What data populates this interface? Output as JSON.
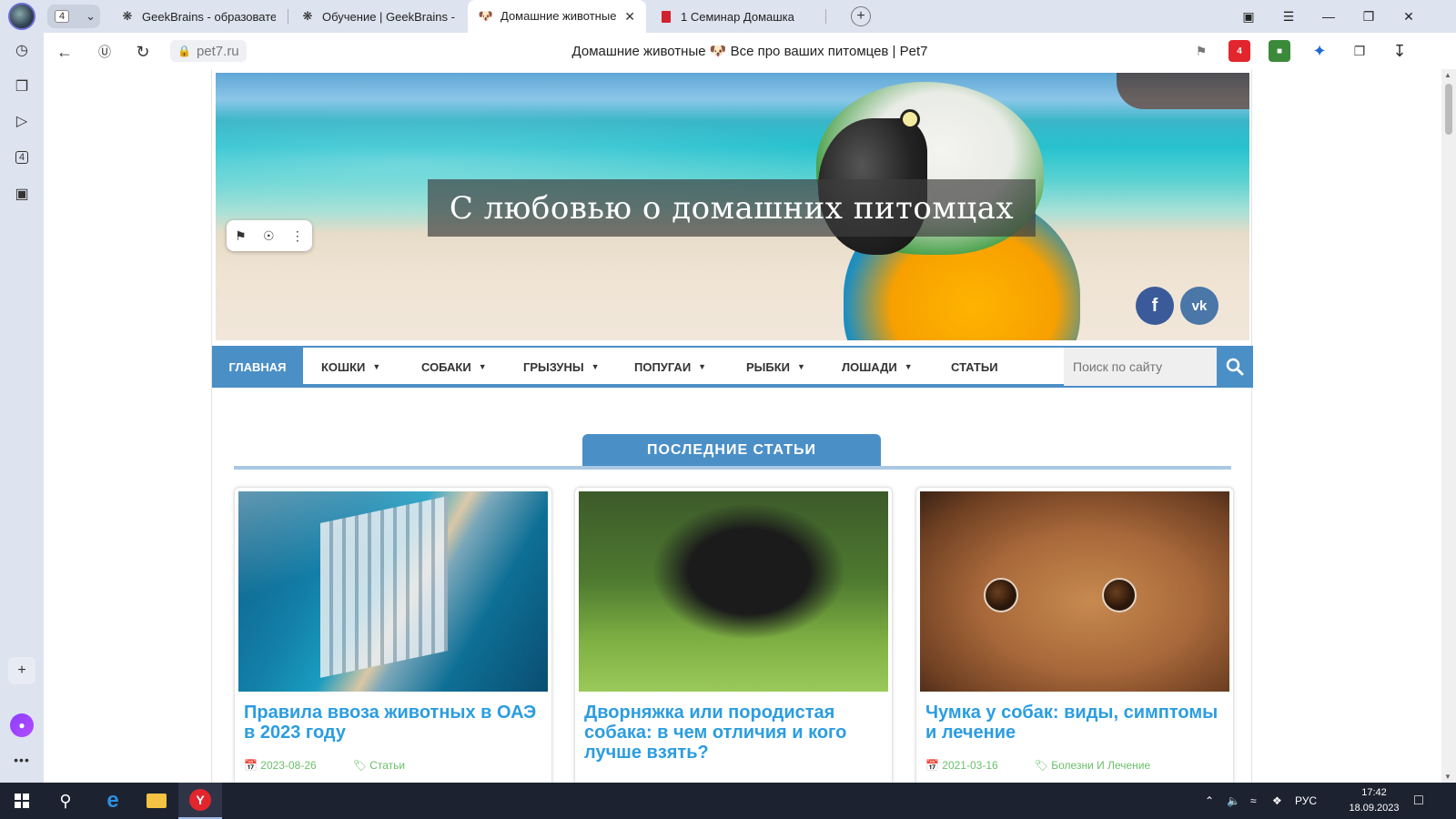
{
  "browser": {
    "tab_group_count": "4",
    "tabs": [
      {
        "title": "GeekBrains - образовател",
        "favicon": "geekbrains-logo"
      },
      {
        "title": "Обучение | GeekBrains - с",
        "favicon": "geekbrains-logo"
      },
      {
        "title": "Домашние животные 🐶",
        "favicon": "dog-icon",
        "active": true
      },
      {
        "title": "1 Семинар Домашка",
        "favicon": "document-red-icon"
      }
    ],
    "address": "pet7.ru",
    "page_title": "Домашние животные 🐶 Все про ваших питомцев | Pet7",
    "sidebar_badge": "4",
    "extension_badge": "4"
  },
  "site": {
    "hero_title": "С любовью о домашних питомцах",
    "social": {
      "facebook": "f",
      "vk": "vk"
    },
    "menu": [
      {
        "label": "ГЛАВНАЯ",
        "active": true,
        "dropdown": false
      },
      {
        "label": "КОШКИ",
        "dropdown": true
      },
      {
        "label": "СОБАКИ",
        "dropdown": true
      },
      {
        "label": "ГРЫЗУНЫ",
        "dropdown": true
      },
      {
        "label": "ПОПУГАИ",
        "dropdown": true
      },
      {
        "label": "РЫБКИ",
        "dropdown": true
      },
      {
        "label": "ЛОШАДИ",
        "dropdown": true
      },
      {
        "label": "СТАТЬИ",
        "dropdown": false
      }
    ],
    "search_placeholder": "Поиск по сайту",
    "section_title": "ПОСЛЕДНИЕ СТАТЬИ",
    "articles": [
      {
        "title": "Правила ввоза животных в ОАЭ в 2023 году",
        "date": "2023-08-26",
        "category": "Статьи"
      },
      {
        "title": "Дворняжка или породистая собака: в чем отличия и кого лучше взять?",
        "date": "",
        "category": ""
      },
      {
        "title": "Чумка у собак: виды, симптомы и лечение",
        "date": "2021-03-16",
        "category": "Болезни И Лечение"
      }
    ]
  },
  "taskbar": {
    "language": "РУС",
    "time": "17:42",
    "date": "18.09.2023"
  },
  "colors": {
    "accent": "#4b8fc7",
    "link": "#2b9de0",
    "taskbar": "#1d2230"
  }
}
